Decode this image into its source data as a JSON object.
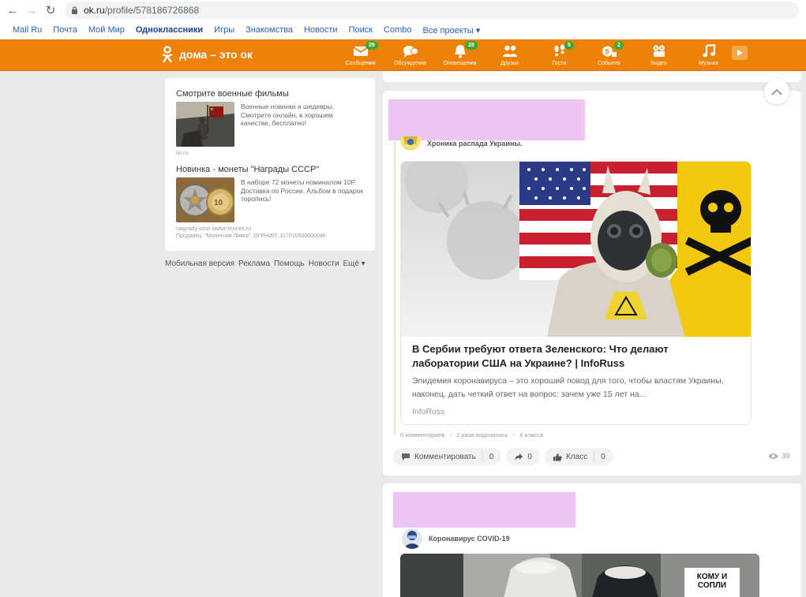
{
  "browser": {
    "url_host": "ok.ru",
    "url_path": "/profile/578186726868"
  },
  "portal_links": [
    "Mail Ru",
    "Почта",
    "Мой Мир",
    "Одноклассники",
    "Игры",
    "Знакомства",
    "Новости",
    "Поиск",
    "Combo",
    "Все проекты ▾"
  ],
  "header": {
    "logo_text": "дома – это ок",
    "toolbar": [
      {
        "label": "Сообщения",
        "badge": "29",
        "icon": "envelope-icon"
      },
      {
        "label": "Обсуждения",
        "badge": "",
        "icon": "chat-bubbles-icon"
      },
      {
        "label": "Оповещения",
        "badge": "28",
        "icon": "bell-icon"
      },
      {
        "label": "Друзья",
        "badge": "",
        "icon": "friends-icon"
      },
      {
        "label": "Гости",
        "badge": "5",
        "icon": "footprints-icon"
      },
      {
        "label": "События",
        "badge": "2",
        "icon": "events-icon"
      },
      {
        "label": "Видео",
        "badge": "",
        "icon": "video-camera-icon"
      },
      {
        "label": "Музыка",
        "badge": "",
        "icon": "music-note-icon"
      }
    ]
  },
  "ads": {
    "ad1": {
      "title": "Смотрите военные фильмы",
      "text": "Военные новинки и шедевры. Смотрите онлайн, в хорошем качестве, бесплатно!",
      "source": "ivi.ru"
    },
    "ad2": {
      "title": "Новинка - монеты \"Награды СССР\"",
      "text": "В наборе 72 монеты номиналом 10Р. Доставка по России. Альбом в подарок торопись!",
      "source": "nagrady-ussr.lavka-monet.ru",
      "seller": "Продавец: \"Монетная Лавка\". ОГРНИП: 317010500000046"
    }
  },
  "footer_links": [
    "Мобильная версия",
    "Реклама",
    "Помощь",
    "Новости",
    "Ещё ▾"
  ],
  "post1": {
    "group_name": "Хроника распада Украины.",
    "article_title": "В Сербии требуют ответа Зеленского: Что делают лаборатории США на Украине? | InfoRuss",
    "article_desc": "Эпидемия коронавируса – это хороший повод для того, чтобы властям Украины, наконец, дать четкий ответ на вопрос: зачем уже 15 лет на...",
    "article_source": "InfoRuss",
    "stats": {
      "comments": "0 комментариев",
      "shares": "2 раза поделились",
      "likes": "4 класса"
    },
    "actions": {
      "comment_label": "Комментировать",
      "comment_count": "0",
      "share_count": "0",
      "like_label": "Класс",
      "like_count": "0"
    },
    "views": "39"
  },
  "post2": {
    "group_name": "Коронавирус COVID-19",
    "image_caption": "КОМУ И СОПЛИ"
  }
}
